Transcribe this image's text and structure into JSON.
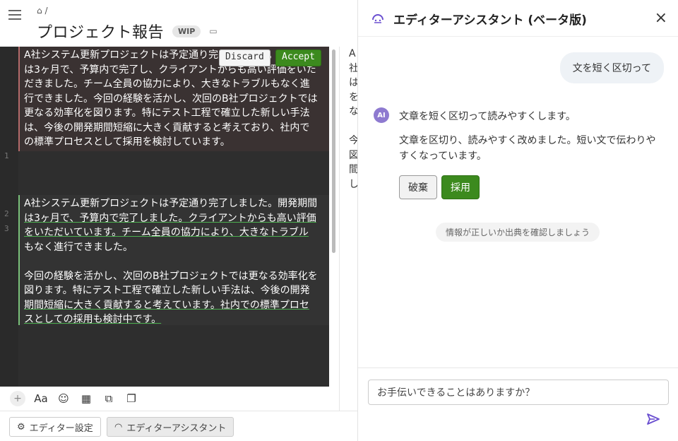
{
  "breadcrumb": {
    "home_icon": "home-icon",
    "separator": "/"
  },
  "header": {
    "title": "プロジェクト報告",
    "badge": "WIP"
  },
  "editor": {
    "gutter_numbers": [
      "1",
      "2",
      "3"
    ],
    "inline_actions": {
      "discard": "Discard",
      "accept": "Accept"
    },
    "deleted_text": [
      "A社システム更新プロジェクトは予定通り完了しました。開発期間",
      "は3ヶ月で、予算内で完了し、クライアントからも高い評価をいた",
      "だきました。チーム全員の協力により、大きなトラブルもなく進",
      "行できました。今回の経験を活かし、次回のB社プロジェクトでは",
      "更なる効率化を図ります。特にテスト工程で確立した新しい手法",
      "は、今後の開発期間短縮に大きく貢献すると考えており、社内で",
      "の標準プロセスとして採用を検討しています。"
    ],
    "added_text": [
      "A社システム更新プロジェクトは予定通り完了しました。開発期間",
      "は3ヶ月で、予算内で完了しました。クライアントからも高い評価",
      "をいただいています。チーム全員の協力により、大きなトラブル",
      "もなく進行できました。",
      "",
      "今回の経験を活かし、次回のB社プロジェクトでは更なる効率化を",
      "図ります。特にテスト工程で確立した新しい手法は、今後の開発",
      "期間短縮に大きく貢献すると考えています。社内での標準プロセ",
      "スとしての採用も検討中です。"
    ]
  },
  "preview_lines": [
    "A社",
    "は",
    "を",
    "な",
    "",
    "今",
    "図",
    "間",
    "し"
  ],
  "toolbar": {
    "plus": "+",
    "font": "Aa",
    "emoji": "☺",
    "table": "▦",
    "diagram": "⧉",
    "copy": "❐"
  },
  "bottom": {
    "settings_label": "エディター設定",
    "assistant_label": "エディターアシスタント"
  },
  "assistant": {
    "title": "エディターアシスタント (ベータ版)",
    "user_message": "文を短く区切って",
    "ai_label": "AI",
    "ai_intro": "文章を短く区切って読みやすくします。",
    "ai_result": "文章を区切り、読みやすく改めました。短い文で伝わりやすくなっています。",
    "discard_label": "破棄",
    "accept_label": "採用",
    "notice": "情報が正しいか出典を確認しましょう",
    "input_placeholder": "お手伝いできることはありますか？",
    "accent_color": "#3c8a1e",
    "send_color": "#6a4fd0"
  }
}
